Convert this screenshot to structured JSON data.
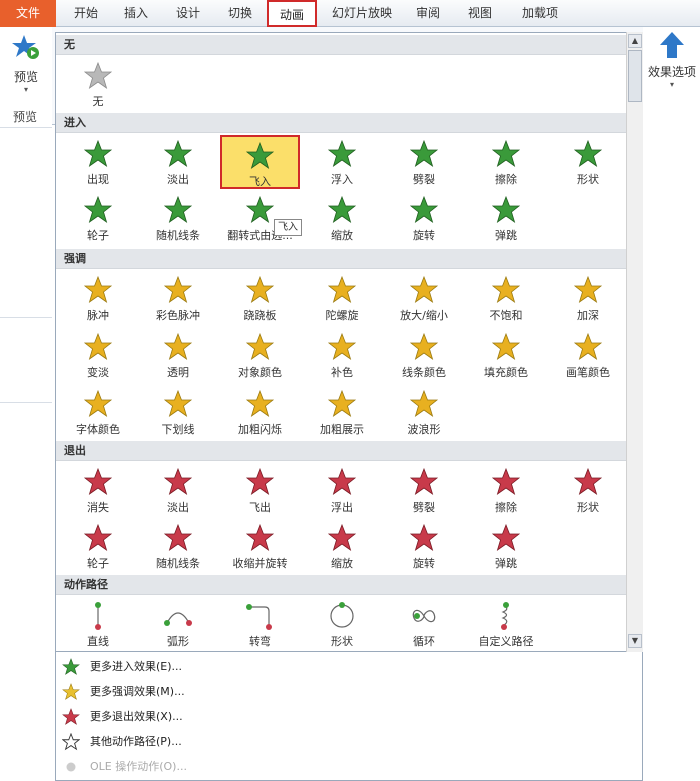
{
  "tabs": [
    {
      "label": "文件",
      "name": "tab-file"
    },
    {
      "label": "开始",
      "name": "tab-home"
    },
    {
      "label": "插入",
      "name": "tab-insert"
    },
    {
      "label": "设计",
      "name": "tab-design"
    },
    {
      "label": "切换",
      "name": "tab-transitions"
    },
    {
      "label": "动画",
      "name": "tab-animations"
    },
    {
      "label": "幻灯片放映",
      "name": "tab-slideshow"
    },
    {
      "label": "审阅",
      "name": "tab-review"
    },
    {
      "label": "视图",
      "name": "tab-view"
    },
    {
      "label": "加载项",
      "name": "tab-addins"
    }
  ],
  "ribbon": {
    "preview_label": "预览",
    "preview_group_label": "预览",
    "effect_options_label": "效果选项"
  },
  "gallery": {
    "sections": {
      "none": "无",
      "entrance": "进入",
      "emphasis": "强调",
      "exit": "退出",
      "motion": "动作路径"
    },
    "none_items": [
      "无"
    ],
    "entrance_items": [
      "出现",
      "淡出",
      "飞入",
      "浮入",
      "劈裂",
      "擦除",
      "形状",
      "轮子",
      "随机线条",
      "翻转式由远...",
      "缩放",
      "旋转",
      "弹跳"
    ],
    "emphasis_items": [
      "脉冲",
      "彩色脉冲",
      "跷跷板",
      "陀螺旋",
      "放大/缩小",
      "不饱和",
      "加深",
      "变淡",
      "透明",
      "对象颜色",
      "补色",
      "线条颜色",
      "填充颜色",
      "画笔颜色",
      "字体颜色",
      "下划线",
      "加粗闪烁",
      "加粗展示",
      "波浪形"
    ],
    "exit_items": [
      "消失",
      "淡出",
      "飞出",
      "浮出",
      "劈裂",
      "擦除",
      "形状",
      "轮子",
      "随机线条",
      "收缩并旋转",
      "缩放",
      "旋转",
      "弹跳"
    ],
    "motion_items": [
      "直线",
      "弧形",
      "转弯",
      "形状",
      "循环",
      "自定义路径"
    ],
    "tooltip": "飞入"
  },
  "menu": [
    "更多进入效果(E)...",
    "更多强调效果(M)...",
    "更多退出效果(X)...",
    "其他动作路径(P)...",
    "OLE 操作动作(O)..."
  ],
  "colors": {
    "entrance": "#3a9a3a",
    "emphasis": "#e8b020",
    "exit": "#c83a4a",
    "selected_bg": "#fbdf6a",
    "highlight_border": "#d02a2a",
    "file_tab": "#e8602c"
  }
}
